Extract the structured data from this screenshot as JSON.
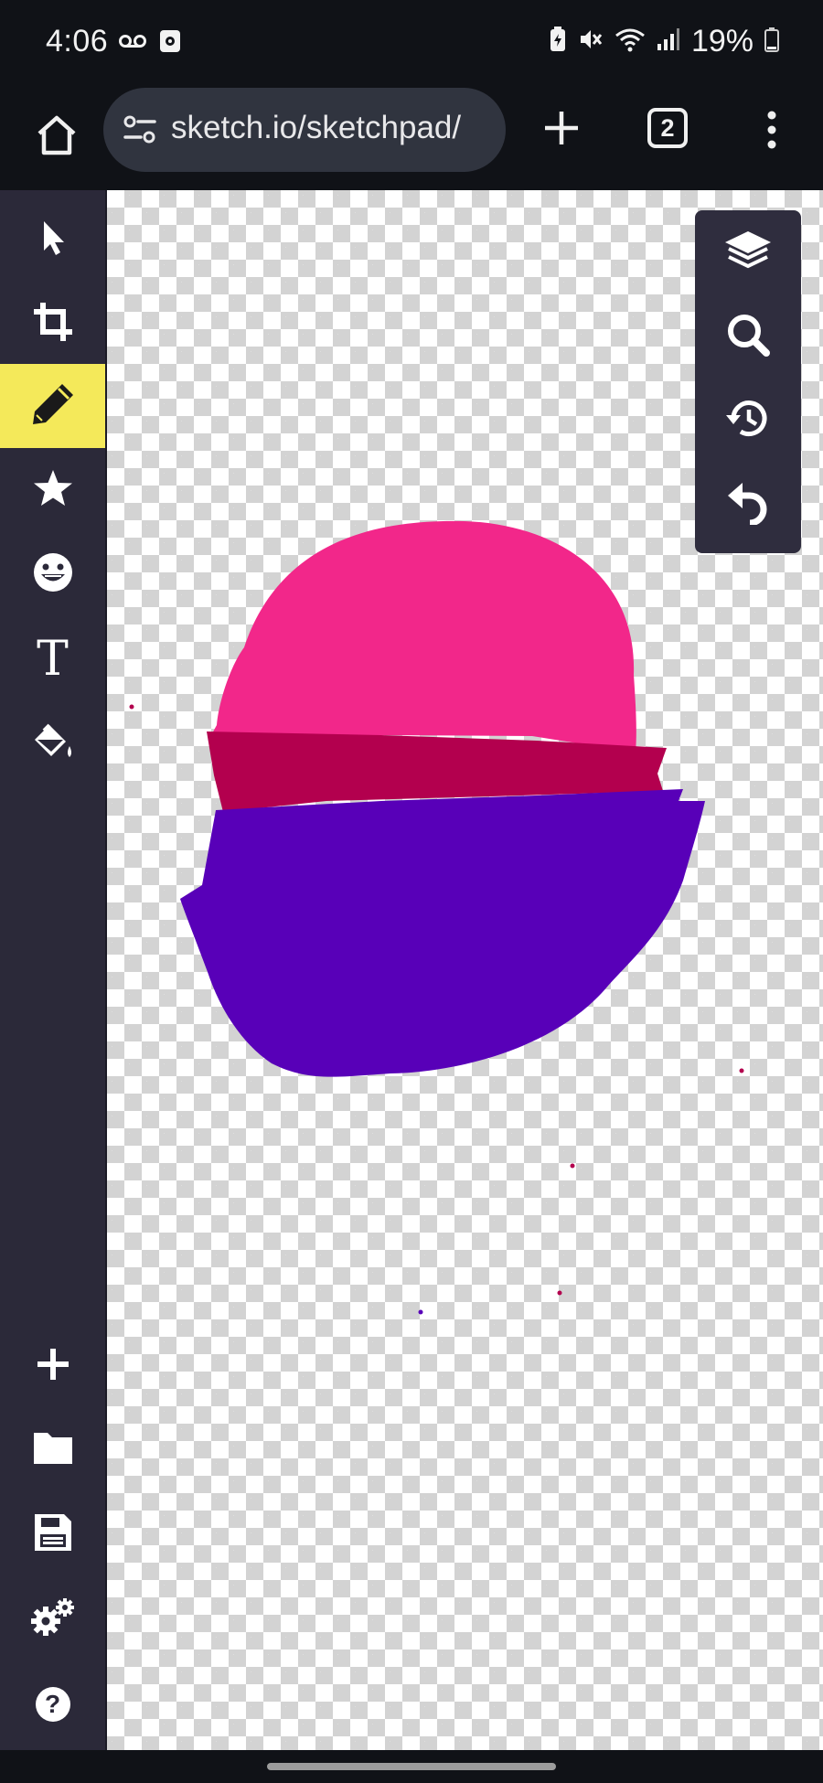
{
  "status_bar": {
    "time": "4:06",
    "battery": "19%",
    "icons": [
      "voicemail-icon",
      "screen-record-icon",
      "battery-saver-icon",
      "mute-icon",
      "wifi-icon",
      "signal-icon",
      "battery-icon"
    ]
  },
  "browser": {
    "url": "sketch.io/sketchpad/",
    "tab_count": "2",
    "icons": [
      "home-icon",
      "site-settings-icon",
      "new-tab-icon",
      "tab-switcher-icon",
      "more-menu-icon"
    ]
  },
  "left_toolbar": {
    "tools": [
      {
        "name": "select",
        "icon": "pointer-icon"
      },
      {
        "name": "crop",
        "icon": "crop-icon"
      },
      {
        "name": "pencil",
        "icon": "pencil-icon",
        "active": true
      },
      {
        "name": "stamp",
        "icon": "star-icon"
      },
      {
        "name": "emoji",
        "icon": "emoji-icon"
      },
      {
        "name": "text",
        "icon": "text-icon",
        "glyph": "T"
      },
      {
        "name": "fill",
        "icon": "paint-bucket-icon"
      }
    ],
    "bottom_tools": [
      {
        "name": "new",
        "icon": "plus-icon"
      },
      {
        "name": "open",
        "icon": "folder-icon"
      },
      {
        "name": "save",
        "icon": "save-icon"
      },
      {
        "name": "settings",
        "icon": "gears-icon"
      },
      {
        "name": "help",
        "icon": "help-icon",
        "glyph": "?"
      }
    ]
  },
  "right_panel": {
    "tools": [
      {
        "name": "layers",
        "icon": "layers-icon"
      },
      {
        "name": "zoom",
        "icon": "zoom-icon"
      },
      {
        "name": "history",
        "icon": "history-icon"
      },
      {
        "name": "undo",
        "icon": "undo-icon"
      }
    ]
  },
  "colors": {
    "accent_active_tool": "#f4e95a",
    "toolbar_bg": "#2b2939",
    "shape_pink": "#f2278a",
    "shape_crimson": "#b3004e",
    "shape_purple": "#5800b8"
  }
}
